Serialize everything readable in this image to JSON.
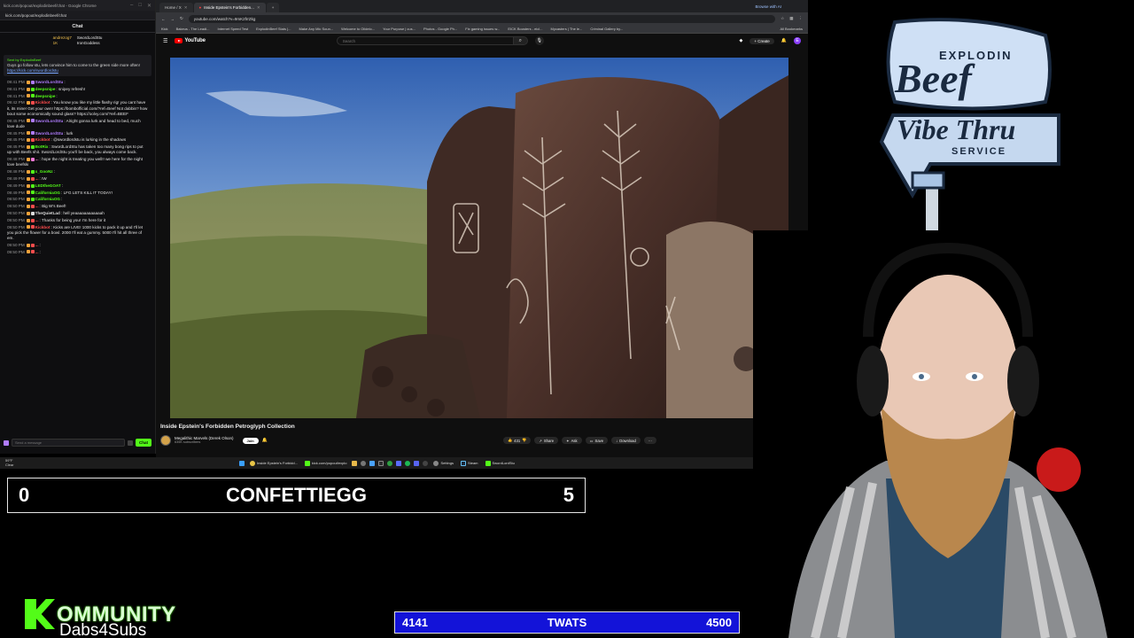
{
  "chat_window": {
    "titlebar": "kick.com/popout/explodinbeef/chat - Google Chrome",
    "url": "kick.com/popout/explodinbeef/chat",
    "header": "Chat",
    "top_users": [
      {
        "name": "andrezog7",
        "extra": "1K"
      },
      {
        "name": "SwordLordStu",
        "extra": "IronGoddess"
      }
    ],
    "pinned": {
      "by": "Sent by ExplodinBeef",
      "text": "Guys go follow stu, lets convince him to come to the green side more often!",
      "link": "https://kick.com/swordlordstu"
    },
    "messages": [
      {
        "time": "09:41 PM",
        "user": "SwordLordStu",
        "color": "#b07cff",
        "text": ""
      },
      {
        "time": "09:41 PM",
        "user": "deepsnipe",
        "color": "#53fc18",
        "text": "snipey refresh!"
      },
      {
        "time": "09:41 PM",
        "user": "deepsnipe",
        "color": "#53fc18",
        "text": ""
      },
      {
        "time": "09:42 PM",
        "user": "Kickbot",
        "color": "#ff4d4d",
        "text": "You know you like my little flashy rig! you cant have it, its mine! Get your own! https://bombofficial.com/?ref=Beef Not dabbin? how bout some economically sound glass? https://oolvy.com/?ref=BEEF"
      },
      {
        "time": "09:45 PM",
        "user": "SwordLordStu",
        "color": "#b07cff",
        "text": "Alright gonna lurk and head to bed, much love dude"
      },
      {
        "time": "09:45 PM",
        "user": "SwordLordStu",
        "color": "#b07cff",
        "text": "lurk"
      },
      {
        "time": "09:45 PM",
        "user": "Kickbot",
        "color": "#ff4d4d",
        "text": "@swordlordstu is lurking in the shadows"
      },
      {
        "time": "09:45 PM",
        "user": "BotRix",
        "color": "#53fc18",
        "text": "SwordLordStu has taken too many bong rips to put up with Beefs shit. SwordLordStu you'll be back, you always come back."
      },
      {
        "time": "09:48 PM",
        "user": "...",
        "color": "#ff7ad9",
        "text": "hope the night is treating you well!! we here for the night love beefski"
      },
      {
        "time": "09:48 PM",
        "user": "x_GooNz",
        "color": "#53fc18",
        "text": ""
      },
      {
        "time": "09:49 PM",
        "user": "...",
        "color": "#ff4d4d",
        "text": "IW"
      },
      {
        "time": "09:49 PM",
        "user": "LEDtheGOAT",
        "color": "#53fc18",
        "text": ""
      },
      {
        "time": "09:49 PM",
        "user": "CaliforniaOG",
        "color": "#53fc18",
        "text": "LFG LETS KILL IT TODAY!"
      },
      {
        "time": "09:50 PM",
        "user": "CaliforniaOG",
        "color": "#53fc18",
        "text": ""
      },
      {
        "time": "09:50 PM",
        "user": "...",
        "color": "#ff4d4d",
        "text": "Big W's Beef!"
      },
      {
        "time": "09:50 PM",
        "user": "TheQuietLad",
        "color": "#dddddd",
        "text": "hell yeaaaaaaaaaaaah"
      },
      {
        "time": "09:50 PM",
        "user": "...",
        "color": "#ff4d4d",
        "text": "Thanks for being you! I'm here for it"
      },
      {
        "time": "09:50 PM",
        "user": "Kickbot",
        "color": "#ff4d4d",
        "text": "Kicks are LIVE! 1000 kicks to pack it up and I'll let you pick the flower for a bowl. 2000 I'll eat a gummy. 5000 I'll hit all three of em."
      },
      {
        "time": "09:50 PM",
        "user": "...",
        "color": "#ff4d4d",
        "text": ""
      },
      {
        "time": "09:50 PM",
        "user": "...",
        "color": "#ff4d4d",
        "text": ""
      }
    ],
    "input_placeholder": "Send a message",
    "send_label": "Chat",
    "status_line": "59°F Clear"
  },
  "browser": {
    "tabs": [
      {
        "label": "Home / X",
        "active": false
      },
      {
        "label": "Inside Epstein's Forbidden...",
        "active": true
      }
    ],
    "ai_label": "Browse with AI",
    "url": "youtube.com/watch?v=9mK2frrZkg",
    "bookmarks": [
      "Kick",
      "Bakeus - The Leadi...",
      "Internet Speed Test",
      "ExplodinBeef Stats |...",
      "Make Any Mic Soun...",
      "Welcome to Oildelo...",
      "Your Purpose | cus...",
      "Photos - Google Ph...",
      "Fix gaming issues w...",
      "EICK Boosters - eicl...",
      "Mycasters | The le...",
      "Criminal Gallery by..."
    ],
    "bookmarks_right": "All Bookmarks"
  },
  "youtube": {
    "logo_text": "YouTube",
    "search_placeholder": "Search",
    "create_label": "+ Create",
    "avatar_letter": "E",
    "video_title": "Inside Epstein's Forbidden Petroglyph Collection",
    "channel_name": "Megalithic Marvels (Derek Olson)",
    "subscribers": "635K subscribers",
    "join_label": "Join",
    "likes": "431",
    "share_label": "Share",
    "ask_label": "Ask",
    "save_label": "Save",
    "download_label": "Download"
  },
  "taskbar": {
    "weather_top": "59°F",
    "weather_bottom": "Clear",
    "items": [
      "Inside Epstein's Forbidd...",
      "kick.com/popout/explo",
      "Settings",
      "Steam",
      "SwordLordStu"
    ]
  },
  "overlays": {
    "score_left": "0",
    "score_title": "CONFETTIEGG",
    "score_right": "5",
    "kommunity_title": "OMMUNITY",
    "kommunity_sub": "Dabs4Subs",
    "goal_current": "4141",
    "goal_title": "TWATS",
    "goal_target": "4500",
    "brand_line1": "EXPLODIN",
    "brand_line2": "Beef",
    "brand_line3": "Vibe Thru",
    "brand_line4": "SERVICE"
  },
  "colors": {
    "kick_green": "#53fc18",
    "goal_blue": "#1313d8",
    "youtube_red": "#ff0000",
    "brand_blue": "#9fc0e6"
  }
}
